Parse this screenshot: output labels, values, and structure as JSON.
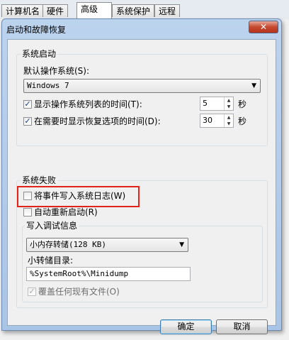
{
  "tabs": [
    "计算机名",
    "硬件",
    "高级",
    "系统保护",
    "远程"
  ],
  "dialog": {
    "title": "启动和故障恢复",
    "close_glyph": "✕"
  },
  "system_startup": {
    "group_label": "系统启动",
    "default_os_label": "默认操作系统(S):",
    "default_os_value": "Windows 7",
    "show_list": {
      "checked": true,
      "label": "显示操作系统列表的时间(T):",
      "value": "5",
      "unit": "秒"
    },
    "show_recovery": {
      "checked": true,
      "label": "在需要时显示恢复选项的时间(D):",
      "value": "30",
      "unit": "秒"
    }
  },
  "system_failure": {
    "group_label": "系统失败",
    "write_event": {
      "checked": false,
      "label": "将事件写入系统日志(W)"
    },
    "auto_restart": {
      "checked": false,
      "label": "自动重新启动(R)"
    },
    "debug_info": {
      "group_label": "写入调试信息",
      "dump_type": "小内存转储(128 KB)",
      "dump_dir_label": "小转储目录:",
      "dump_dir_value": "%SystemRoot%\\Minidump",
      "overwrite": {
        "checked": true,
        "disabled": true,
        "label": "覆盖任何现有文件(O)"
      }
    }
  },
  "buttons": {
    "ok": "确定",
    "cancel": "取消"
  },
  "icons": {
    "check": "✓",
    "dropdown": "▼",
    "spin_up": "▲",
    "spin_down": "▼"
  },
  "colors": {
    "highlight": "#e2231a",
    "title_bar": "#bcd3ee"
  }
}
